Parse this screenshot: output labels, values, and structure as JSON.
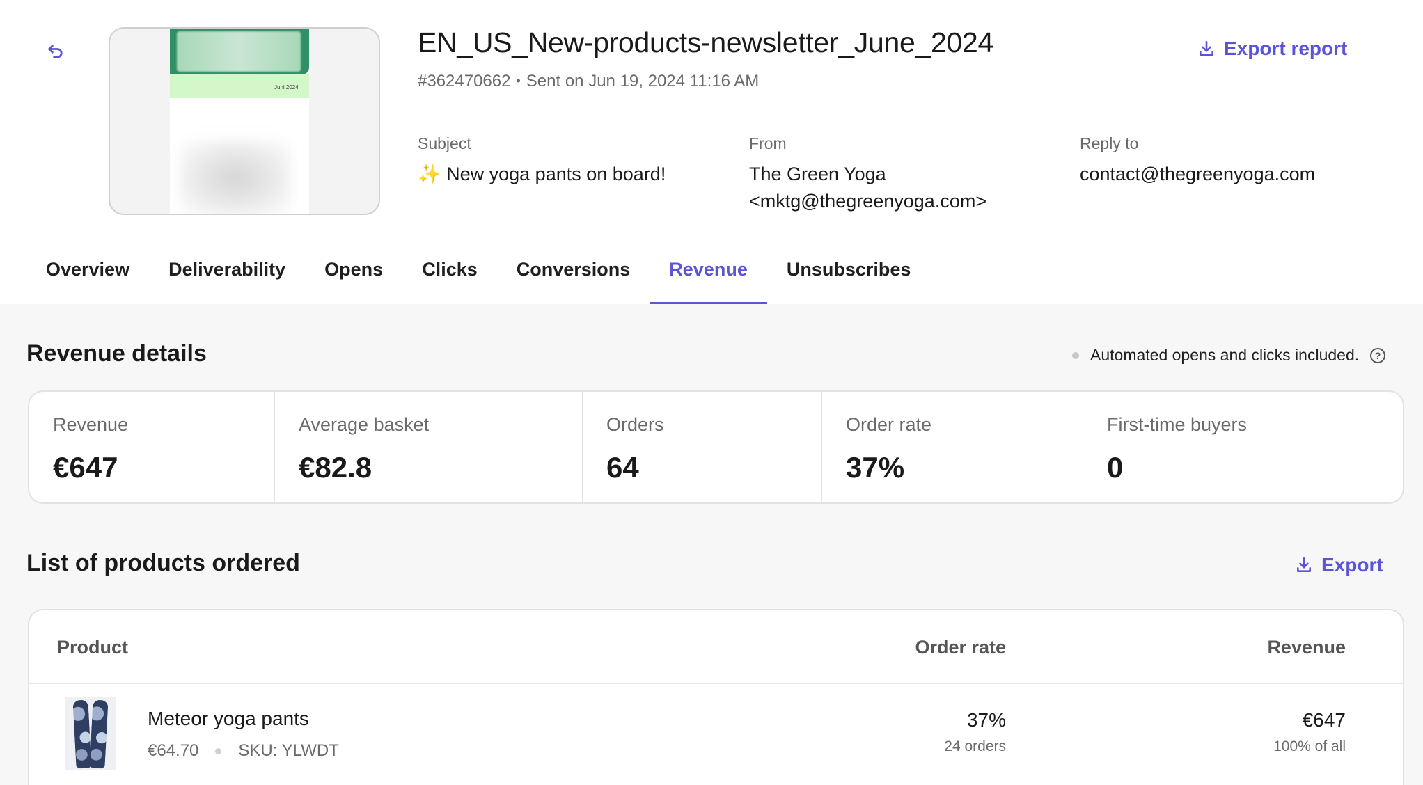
{
  "campaign": {
    "title": "EN_US_New-products-newsletter_June_2024",
    "id": "#362470662",
    "sent": "Sent on Jun 19, 2024 11:16 AM",
    "thumbnail_date": "Juni 2024"
  },
  "actions": {
    "export_report": "Export report",
    "export": "Export"
  },
  "details": {
    "subject_label": "Subject",
    "subject_value": "✨ New yoga pants on board!",
    "from_label": "From",
    "from_name": "The Green Yoga",
    "from_email": "<mktg@thegreenyoga.com>",
    "reply_label": "Reply to",
    "reply_value": "contact@thegreenyoga.com"
  },
  "tabs": [
    {
      "label": "Overview"
    },
    {
      "label": "Deliverability"
    },
    {
      "label": "Opens"
    },
    {
      "label": "Clicks"
    },
    {
      "label": "Conversions"
    },
    {
      "label": "Revenue",
      "active": true
    },
    {
      "label": "Unsubscribes"
    }
  ],
  "revenue_details": {
    "title": "Revenue details",
    "note": "Automated opens and clicks included.",
    "stats": [
      {
        "label": "Revenue",
        "value": "€647"
      },
      {
        "label": "Average basket",
        "value": "€82.8"
      },
      {
        "label": "Orders",
        "value": "64"
      },
      {
        "label": "Order rate",
        "value": "37%"
      },
      {
        "label": "First-time buyers",
        "value": "0"
      }
    ]
  },
  "products": {
    "title": "List of products ordered",
    "columns": {
      "product": "Product",
      "order_rate": "Order rate",
      "revenue": "Revenue"
    },
    "rows": [
      {
        "name": "Meteor yoga pants",
        "price": "€64.70",
        "sku": "SKU: YLWDT",
        "order_rate": "37%",
        "orders": "24 orders",
        "revenue": "€647",
        "revenue_share": "100% of all"
      }
    ]
  },
  "colors": {
    "accent": "#5b53d8",
    "thumbnail_green": "#2f8f66",
    "thumbnail_light": "#d3f7c8"
  }
}
